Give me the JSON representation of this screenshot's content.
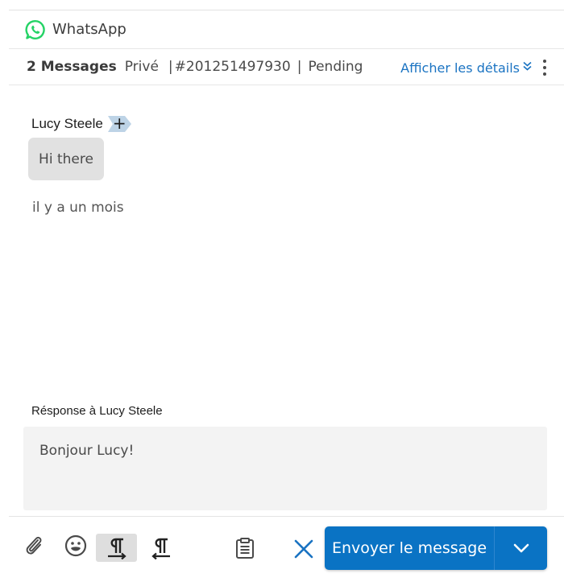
{
  "channel": {
    "name": "WhatsApp",
    "icon": "whatsapp-icon"
  },
  "conversation": {
    "message_count": "2 Messages",
    "visibility": "Privé",
    "separator_1": "|",
    "ticket_id": "#201251497930",
    "separator_2": "|",
    "status": "Pending",
    "details_link": "Afficher les détails"
  },
  "message": {
    "sender": "Lucy Steele",
    "add_label": "+",
    "text": "Hi there",
    "timestamp": "il y a un mois"
  },
  "reply": {
    "label": "Résponse à Lucy Steele",
    "draft": "Bonjour Lucy!"
  },
  "toolbar": {
    "icons": [
      "paperclip-icon",
      "emoji-icon",
      "paragraph-ltr-icon",
      "paragraph-rtl-icon",
      "clipboard-icon",
      "close-icon"
    ],
    "send_label": "Envoyer le message"
  },
  "colors": {
    "accent": "#0a73c4",
    "link": "#1a73c2",
    "whatsapp": "#25d366",
    "bubble": "#e1e1e1",
    "reply_bg": "#f3f3f3"
  }
}
